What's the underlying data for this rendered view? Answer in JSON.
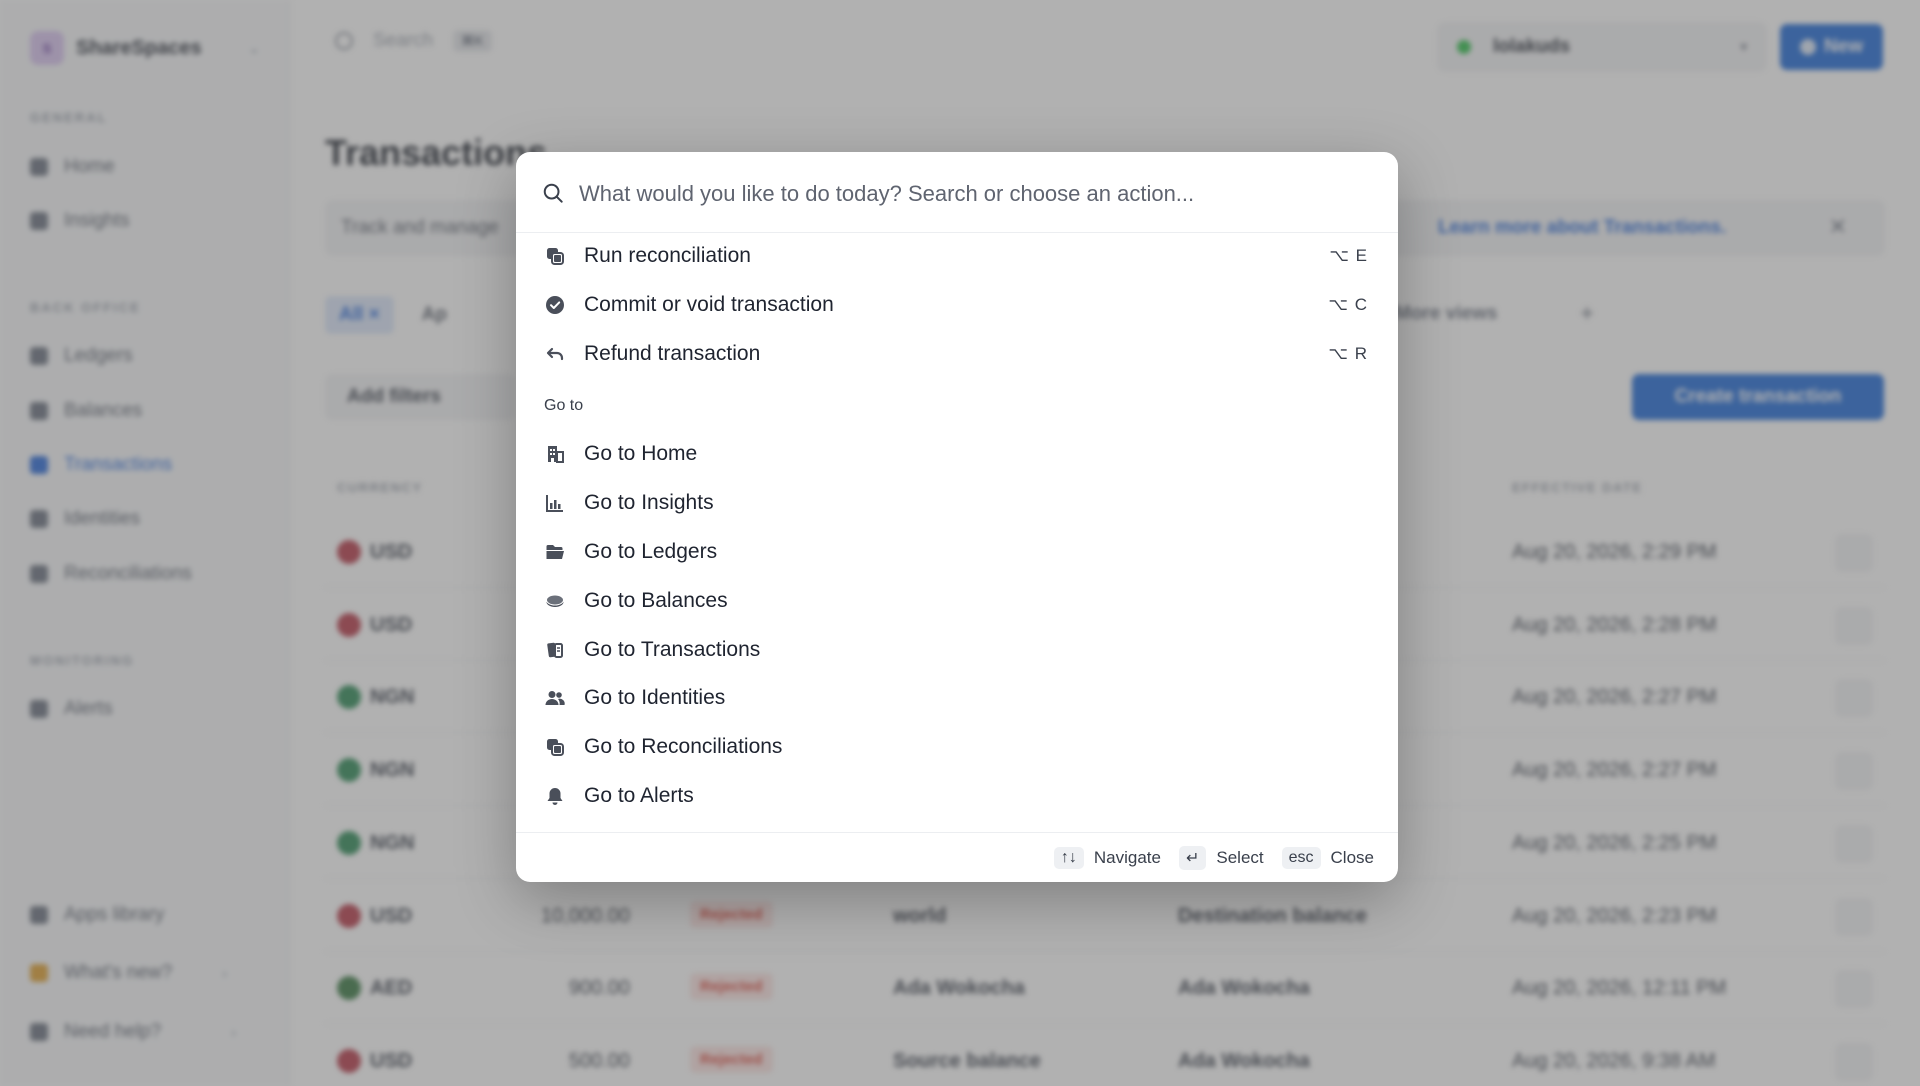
{
  "app": {
    "workspace": {
      "initial": "S",
      "name": "ShareSpaces"
    },
    "sidebar": {
      "sections": [
        {
          "title": "GENERAL",
          "items": [
            "Home",
            "Insights"
          ]
        },
        {
          "title": "BACK OFFICE",
          "items": [
            "Ledgers",
            "Balances",
            "Transactions",
            "Identities",
            "Reconciliations"
          ]
        },
        {
          "title": "MONITORING",
          "items": [
            "Alerts"
          ]
        }
      ],
      "active_item": "Transactions",
      "bottom": {
        "apps": "Apps library",
        "whats_new": "What's new?",
        "help": "Need help?"
      }
    },
    "topbar": {
      "search_label": "Search",
      "search_kbd": "⌘K",
      "environment": "lolakuds",
      "new_label": "New"
    },
    "page_title": "Transactions",
    "info": {
      "text": "Track and manage",
      "link": "Learn more about Transactions.",
      "close": "✕"
    },
    "views": {
      "all": "All",
      "all_x": "×",
      "approved_abbr": "Ap",
      "more_views": "More views",
      "add": "+"
    },
    "add_filters": "Add filters",
    "create_transaction": "Create transaction",
    "table": {
      "headers": {
        "currency": "CURRENCY",
        "effective_date": "EFFECTIVE DATE"
      },
      "rows": [
        {
          "currency": "USD",
          "amount": "",
          "status": "",
          "source": "",
          "destination": "",
          "date": "Aug 20, 2026, 2:29 PM"
        },
        {
          "currency": "USD",
          "amount": "",
          "status": "",
          "source": "",
          "destination": "",
          "date": "Aug 20, 2026, 2:28 PM"
        },
        {
          "currency": "NGN",
          "amount": "",
          "status": "",
          "source": "",
          "destination": "",
          "date": "Aug 20, 2026, 2:27 PM"
        },
        {
          "currency": "NGN",
          "amount": "",
          "status": "",
          "source": "",
          "destination": "",
          "date": "Aug 20, 2026, 2:27 PM"
        },
        {
          "currency": "NGN",
          "amount": "",
          "status": "",
          "source": "",
          "destination": "",
          "date": "Aug 20, 2026, 2:25 PM"
        },
        {
          "currency": "USD",
          "amount": "10,000.00",
          "status": "Rejected",
          "source": "world",
          "destination": "Destination balance",
          "date": "Aug 20, 2026, 2:23 PM"
        },
        {
          "currency": "AED",
          "amount": "900.00",
          "status": "Rejected",
          "source": "Ada Wokocha",
          "destination": "Ada Wokocha",
          "date": "Aug 20, 2026, 12:11 PM"
        },
        {
          "currency": "USD",
          "amount": "500.00",
          "status": "Rejected",
          "source": "Source balance",
          "destination": "Ada Wokocha",
          "date": "Aug 20, 2026, 9:38 AM"
        }
      ]
    }
  },
  "palette": {
    "search_placeholder": "What would you like to do today? Search or choose an action...",
    "actions": [
      {
        "label": "Run reconciliation",
        "shortcut": "⌥ E",
        "icon": "reconcile-icon"
      },
      {
        "label": "Commit or void transaction",
        "shortcut": "⌥ C",
        "icon": "check-circle-icon"
      },
      {
        "label": "Refund transaction",
        "shortcut": "⌥ R",
        "icon": "undo-icon"
      }
    ],
    "goto_title": "Go to",
    "goto": [
      {
        "label": "Go to Home",
        "icon": "building-icon"
      },
      {
        "label": "Go to Insights",
        "icon": "bar-chart-icon"
      },
      {
        "label": "Go to Ledgers",
        "icon": "folder-icon"
      },
      {
        "label": "Go to Balances",
        "icon": "coins-icon"
      },
      {
        "label": "Go to Transactions",
        "icon": "transactions-icon"
      },
      {
        "label": "Go to Identities",
        "icon": "users-icon"
      },
      {
        "label": "Go to Reconciliations",
        "icon": "reconcile-icon"
      },
      {
        "label": "Go to Alerts",
        "icon": "bell-icon"
      }
    ],
    "footer": {
      "navigate_key": "↑↓",
      "navigate": "Navigate",
      "select_key": "↵",
      "select": "Select",
      "close_key": "esc",
      "close": "Close"
    }
  },
  "colors": {
    "accent": "#1f6ad8",
    "overlay": "#5c5c5c",
    "rejected": "#d9463a"
  }
}
